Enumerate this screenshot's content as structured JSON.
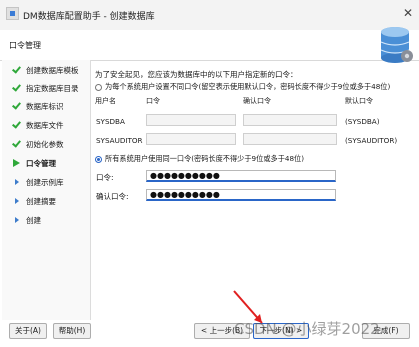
{
  "window": {
    "title": "DM数据库配置助手 - 创建数据库",
    "close_glyph": "✕"
  },
  "header": {
    "title": "口令管理"
  },
  "sidebar": {
    "items": [
      {
        "label": "创建数据库模板",
        "state": "done"
      },
      {
        "label": "指定数据库目录",
        "state": "done"
      },
      {
        "label": "数据库标识",
        "state": "done"
      },
      {
        "label": "数据库文件",
        "state": "done"
      },
      {
        "label": "初始化参数",
        "state": "done"
      },
      {
        "label": "口令管理",
        "state": "current"
      },
      {
        "label": "创建示例库",
        "state": "pending"
      },
      {
        "label": "创建摘要",
        "state": "pending"
      },
      {
        "label": "创建",
        "state": "pending"
      }
    ]
  },
  "main": {
    "intro": "为了安全起见，您应该为数据库中的以下用户指定新的口令：",
    "option_individual": "为每个系统用户设置不同口令(留空表示使用默认口令，密码长度不得少于9位或多于48位)",
    "columns": {
      "user": "用户名",
      "password": "口令",
      "confirm": "确认口令",
      "default": "默认口令"
    },
    "users": [
      {
        "name": "SYSDBA",
        "default": "(SYSDBA)"
      },
      {
        "name": "SYSAUDITOR",
        "default": "(SYSAUDITOR)"
      }
    ],
    "option_same": "所有系统用户使用同一口令(密码长度不得少于9位或多于48位)",
    "password_label": "口令:",
    "password_value": "●●●●●●●●●●",
    "confirm_label": "确认口令:",
    "confirm_value": "●●●●●●●●●●"
  },
  "footer": {
    "about": "关于(A)",
    "help": "帮助(H)",
    "back": "< 上一步(B)",
    "next": "下一步(N) >",
    "finish": "完成(F)"
  },
  "watermark": "CSDN @小绿芽2022",
  "colors": {
    "accent": "#2a66c8",
    "check": "#2fa83a",
    "arrow": "#e02020"
  }
}
